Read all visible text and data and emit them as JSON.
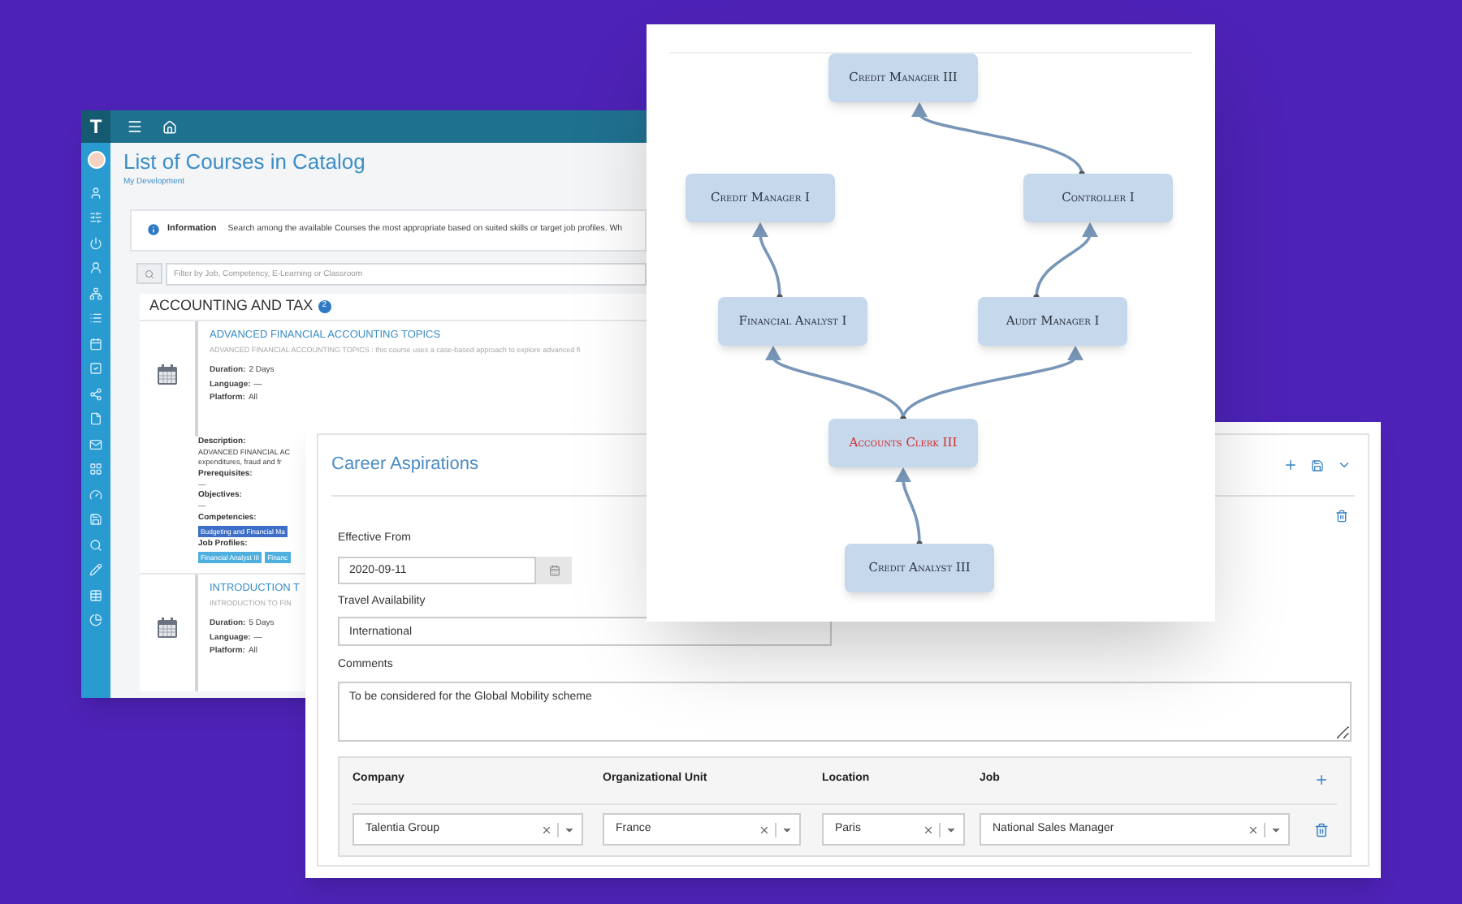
{
  "catalog": {
    "logo": "T",
    "title": "List of Courses in Catalog",
    "breadcrumb": "My Development",
    "info": {
      "label": "Information",
      "text": "Search among the available Courses the most appropriate based on suited skills or target job profiles. Wh"
    },
    "search": {
      "placeholder": "Filter by Job, Competency, E-Learning or Classroom"
    },
    "section": {
      "title": "ACCOUNTING AND TAX",
      "badge": "2"
    },
    "courses": [
      {
        "title": "ADVANCED FINANCIAL ACCOUNTING TOPICS",
        "summary": "ADVANCED FINANCIAL ACCOUNTING TOPICS : this course uses a case-based approach to explore advanced fi",
        "fields": [
          {
            "label": "Duration:",
            "value": "2 Days"
          },
          {
            "label": "Language:",
            "value": "—"
          },
          {
            "label": "Platform:",
            "value": "All"
          }
        ],
        "details": [
          {
            "kind": "text",
            "label": "Description:",
            "lines": [
              "ADVANCED FINANCIAL AC",
              "expenditures, fraud and fr"
            ]
          },
          {
            "kind": "text",
            "label": "Prerequisites:",
            "lines": [
              "—"
            ]
          },
          {
            "kind": "text",
            "label": "Objectives:",
            "lines": [
              "—"
            ]
          },
          {
            "kind": "tags",
            "label": "Competencies:",
            "tags": [
              {
                "text": "Budgeting and Financial Ma",
                "color": "#3d6fc6"
              }
            ]
          },
          {
            "kind": "tags",
            "label": "Job Profiles:",
            "tags": [
              {
                "text": "Financial Analyst III",
                "color": "#4fb0e0"
              },
              {
                "text": "Financ",
                "color": "#4fb0e0"
              }
            ]
          }
        ]
      },
      {
        "title": "INTRODUCTION T",
        "summary": "INTRODUCTION TO FIN",
        "fields": [
          {
            "label": "Duration:",
            "value": "5 Days"
          },
          {
            "label": "Language:",
            "value": "—"
          },
          {
            "label": "Platform:",
            "value": "All"
          }
        ]
      }
    ]
  },
  "career": {
    "title": "Career Aspirations",
    "effective_from": {
      "label": "Effective From",
      "value": "2020-09-11"
    },
    "travel": {
      "label": "Travel Availability",
      "value": "International"
    },
    "comments": {
      "label": "Comments",
      "value": "To be considered for the Global Mobility scheme"
    },
    "table": {
      "columns": [
        "Company",
        "Organizational Unit",
        "Location",
        "Job"
      ],
      "rows": [
        {
          "cells": [
            "Talentia Group",
            "France",
            "Paris",
            "National Sales Manager"
          ]
        }
      ]
    }
  },
  "org_chart": {
    "nodes": [
      {
        "label": "Credit Manager III",
        "highlighted": false
      },
      {
        "label": "Credit Manager I",
        "highlighted": false
      },
      {
        "label": "Controller I",
        "highlighted": false
      },
      {
        "label": "Financial Analyst I",
        "highlighted": false
      },
      {
        "label": "Audit Manager I",
        "highlighted": false
      },
      {
        "label": "Accounts Clerk III",
        "highlighted": true
      },
      {
        "label": "Credit Analyst III",
        "highlighted": false
      }
    ]
  }
}
